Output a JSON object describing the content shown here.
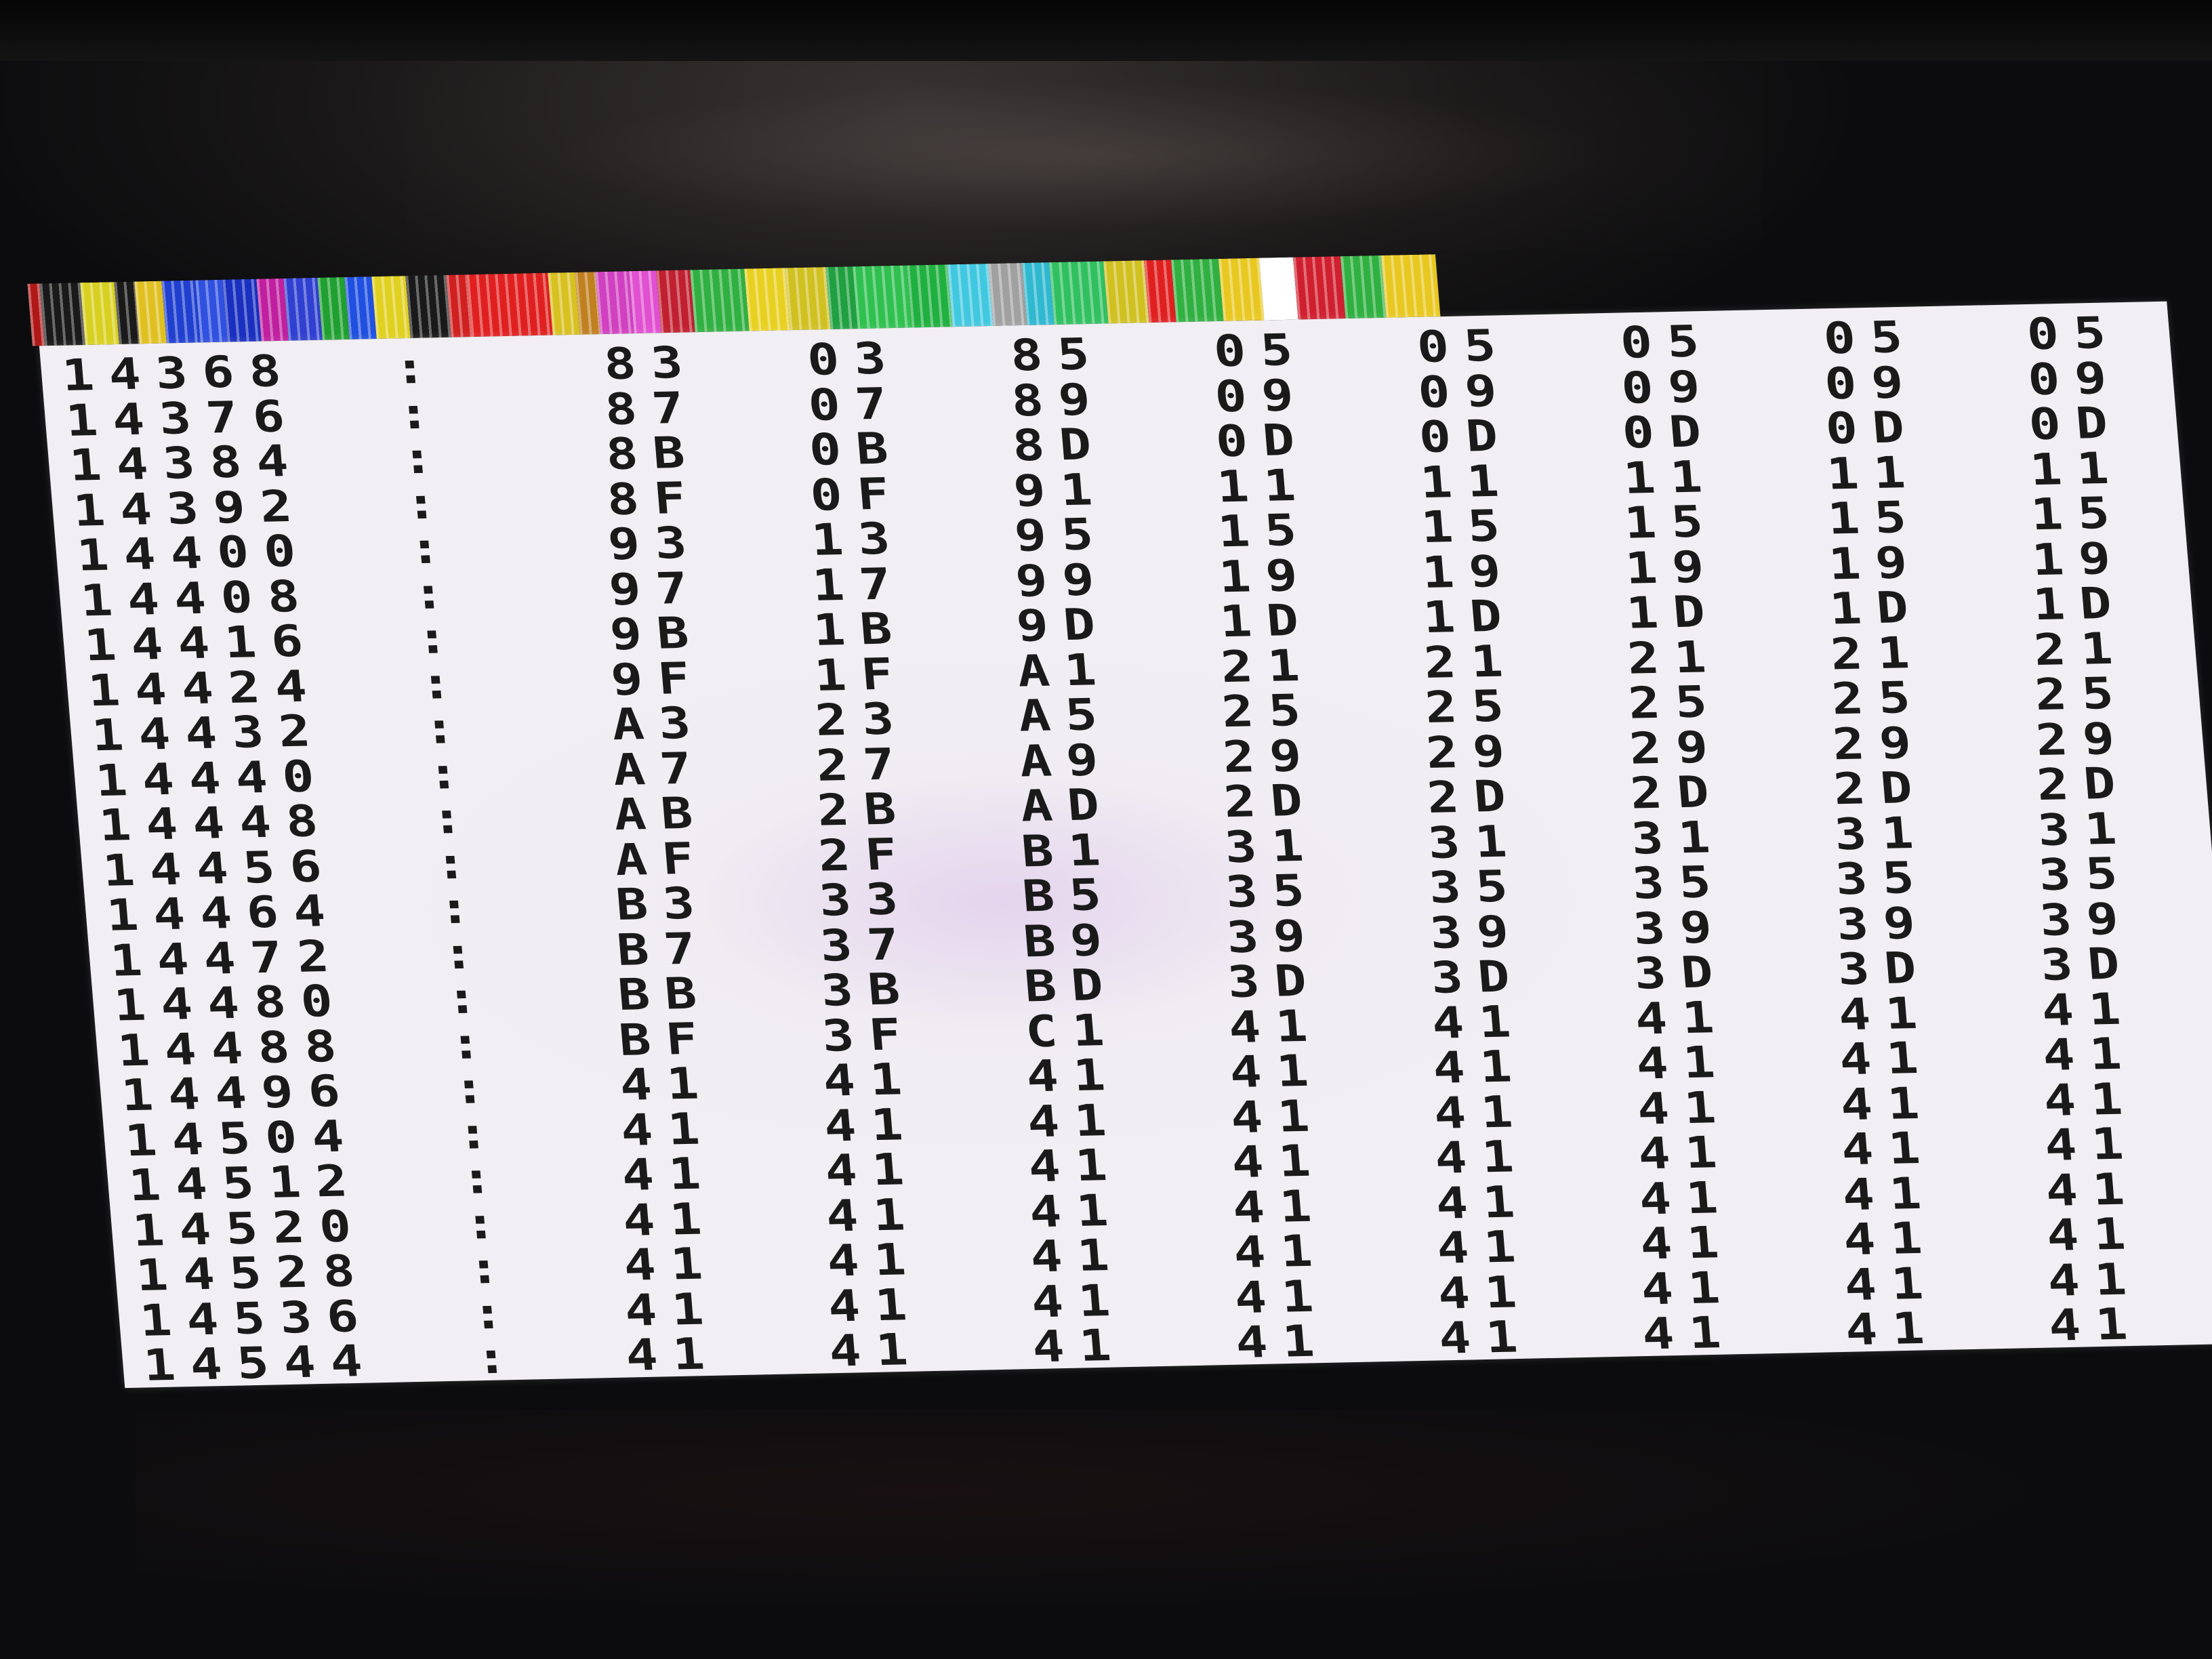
{
  "dump": {
    "rows": [
      {
        "addr": "14368",
        "bytes": [
          "83",
          "03",
          "85",
          "05",
          "05",
          "05",
          "05",
          "05"
        ]
      },
      {
        "addr": "14376",
        "bytes": [
          "87",
          "07",
          "89",
          "09",
          "09",
          "09",
          "09",
          "09"
        ]
      },
      {
        "addr": "14384",
        "bytes": [
          "8B",
          "0B",
          "8D",
          "0D",
          "0D",
          "0D",
          "0D",
          "0D"
        ]
      },
      {
        "addr": "14392",
        "bytes": [
          "8F",
          "0F",
          "91",
          "11",
          "11",
          "11",
          "11",
          "11"
        ]
      },
      {
        "addr": "14400",
        "bytes": [
          "93",
          "13",
          "95",
          "15",
          "15",
          "15",
          "15",
          "15"
        ]
      },
      {
        "addr": "14408",
        "bytes": [
          "97",
          "17",
          "99",
          "19",
          "19",
          "19",
          "19",
          "19"
        ]
      },
      {
        "addr": "14416",
        "bytes": [
          "9B",
          "1B",
          "9D",
          "1D",
          "1D",
          "1D",
          "1D",
          "1D"
        ]
      },
      {
        "addr": "14424",
        "bytes": [
          "9F",
          "1F",
          "A1",
          "21",
          "21",
          "21",
          "21",
          "21"
        ]
      },
      {
        "addr": "14432",
        "bytes": [
          "A3",
          "23",
          "A5",
          "25",
          "25",
          "25",
          "25",
          "25"
        ]
      },
      {
        "addr": "14440",
        "bytes": [
          "A7",
          "27",
          "A9",
          "29",
          "29",
          "29",
          "29",
          "29"
        ]
      },
      {
        "addr": "14448",
        "bytes": [
          "AB",
          "2B",
          "AD",
          "2D",
          "2D",
          "2D",
          "2D",
          "2D"
        ]
      },
      {
        "addr": "14456",
        "bytes": [
          "AF",
          "2F",
          "B1",
          "31",
          "31",
          "31",
          "31",
          "31"
        ]
      },
      {
        "addr": "14464",
        "bytes": [
          "B3",
          "33",
          "B5",
          "35",
          "35",
          "35",
          "35",
          "35"
        ]
      },
      {
        "addr": "14472",
        "bytes": [
          "B7",
          "37",
          "B9",
          "39",
          "39",
          "39",
          "39",
          "39"
        ]
      },
      {
        "addr": "14480",
        "bytes": [
          "BB",
          "3B",
          "BD",
          "3D",
          "3D",
          "3D",
          "3D",
          "3D"
        ]
      },
      {
        "addr": "14488",
        "bytes": [
          "BF",
          "3F",
          "C1",
          "41",
          "41",
          "41",
          "41",
          "41"
        ]
      },
      {
        "addr": "14496",
        "bytes": [
          "41",
          "41",
          "41",
          "41",
          "41",
          "41",
          "41",
          "41"
        ]
      },
      {
        "addr": "14504",
        "bytes": [
          "41",
          "41",
          "41",
          "41",
          "41",
          "41",
          "41",
          "41"
        ]
      },
      {
        "addr": "14512",
        "bytes": [
          "41",
          "41",
          "41",
          "41",
          "41",
          "41",
          "41",
          "41"
        ]
      },
      {
        "addr": "14520",
        "bytes": [
          "41",
          "41",
          "41",
          "41",
          "41",
          "41",
          "41",
          "41"
        ]
      },
      {
        "addr": "14528",
        "bytes": [
          "41",
          "41",
          "41",
          "41",
          "41",
          "41",
          "41",
          "41"
        ]
      },
      {
        "addr": "14536",
        "bytes": [
          "41",
          "41",
          "41",
          "41",
          "41",
          "41",
          "41",
          "41"
        ]
      },
      {
        "addr": "14544",
        "bytes": [
          "41",
          "41",
          "41",
          "41",
          "41",
          "41",
          "41",
          "41"
        ]
      }
    ],
    "separator": ":"
  },
  "border_stripes": {
    "colors": [
      "#b01818",
      "#1a1a1a",
      "#d8d020",
      "#1a1a1a",
      "#e0c020",
      "#2040d0",
      "#3050e0",
      "#1a30c0",
      "#c020a0",
      "#3040d0",
      "#20a030",
      "#2050e0",
      "#e0d020",
      "#1a1a1a",
      "#d02020",
      "#e02020",
      "#d8c020",
      "#c08020",
      "#d040c0",
      "#e050d0",
      "#c02030",
      "#30b040",
      "#e8d020",
      "#d0c020",
      "#20a040",
      "#30c050",
      "#20b040",
      "#40c8e0",
      "#a0a0a0",
      "#30b8d0",
      "#30c060",
      "#d0c020",
      "#e02020",
      "#30b040",
      "#e8c820",
      "#ffffff",
      "#d02030",
      "#30b040",
      "#e8c820"
    ]
  }
}
